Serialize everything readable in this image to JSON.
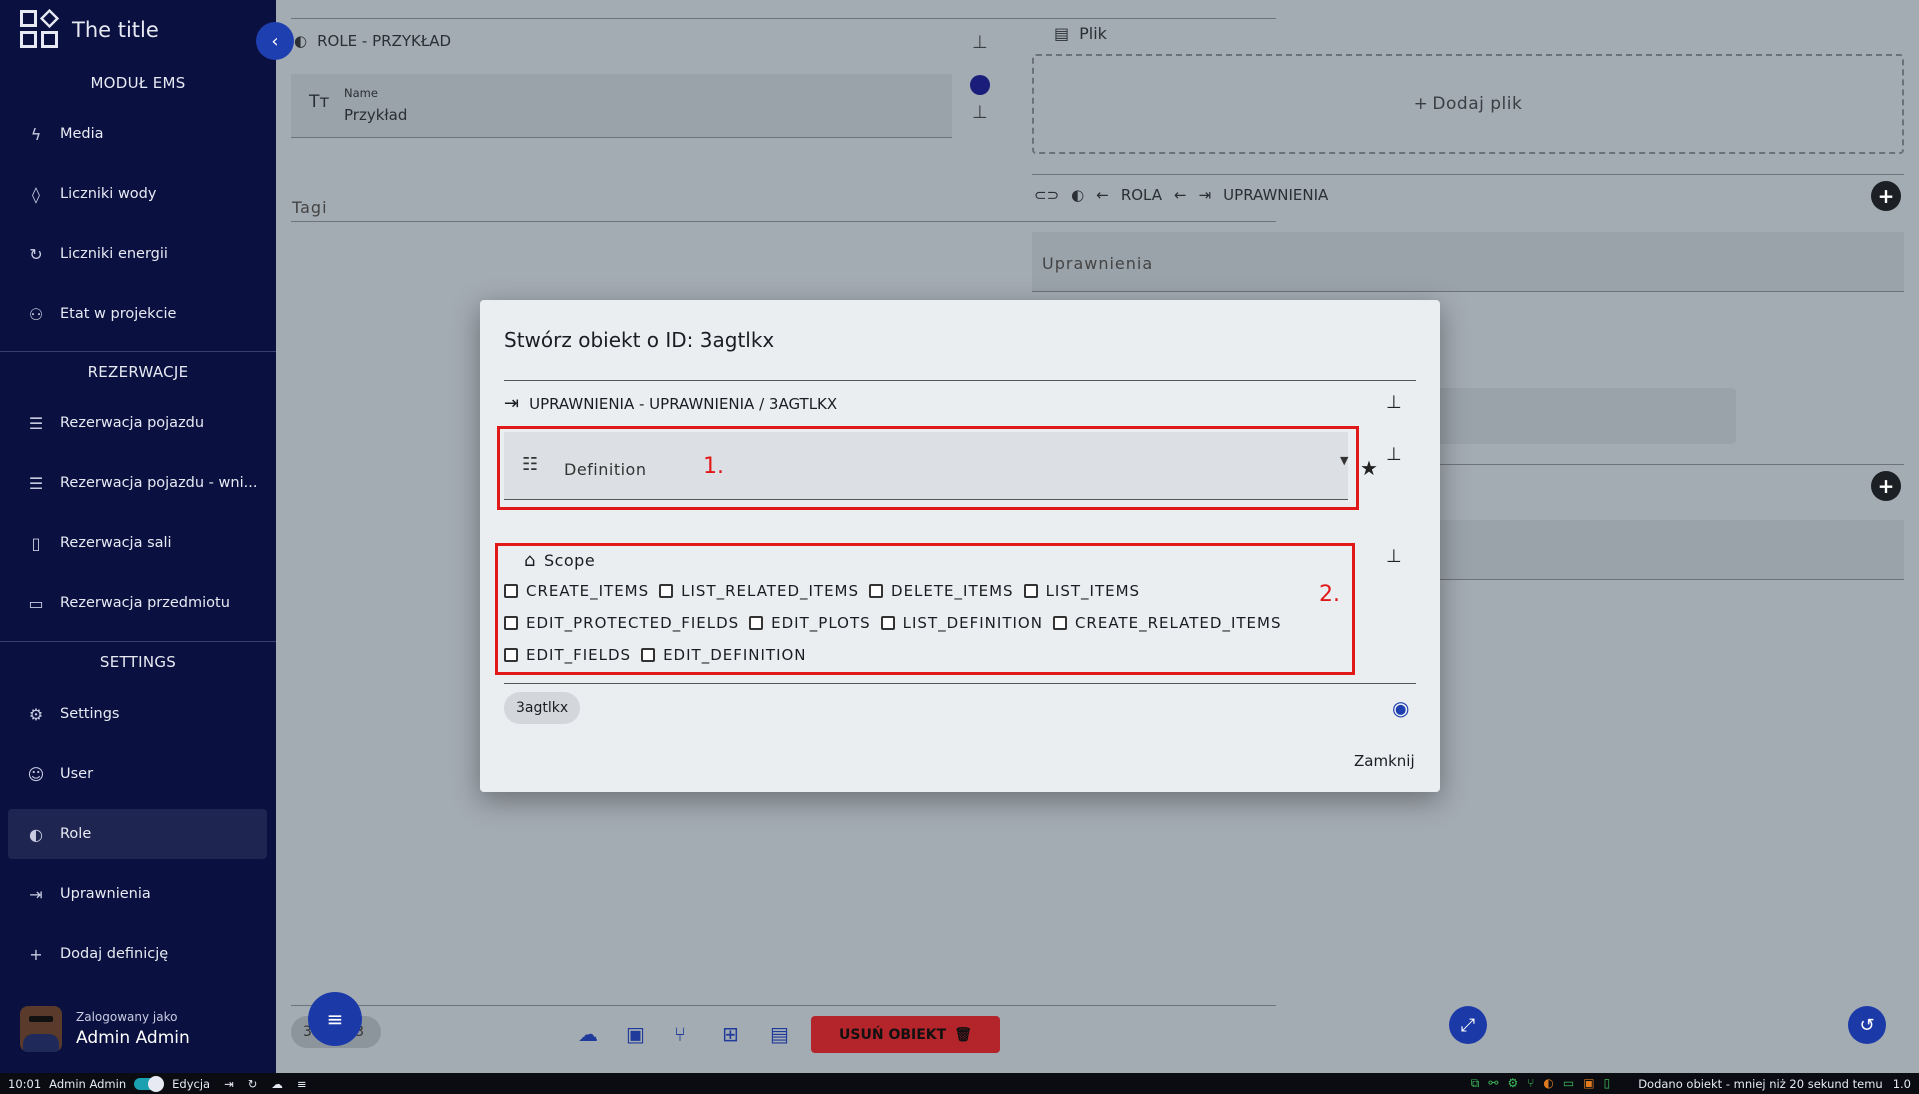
{
  "app": {
    "title": "The title"
  },
  "sidebar": {
    "sections": [
      {
        "title": "MODUŁ EMS",
        "items": [
          {
            "label": "Media",
            "icon": "bolt-icon"
          },
          {
            "label": "Liczniki wody",
            "icon": "drop-icon"
          },
          {
            "label": "Liczniki energii",
            "icon": "history-icon"
          },
          {
            "label": "Etat w projekcie",
            "icon": "people-icon"
          }
        ]
      },
      {
        "title": "REZERWACJE",
        "items": [
          {
            "label": "Rezerwacja pojazdu",
            "icon": "bed-icon"
          },
          {
            "label": "Rezerwacja pojazdu - wni...",
            "icon": "bed-icon"
          },
          {
            "label": "Rezerwacja sali",
            "icon": "bookmark-icon"
          },
          {
            "label": "Rezerwacja przedmiotu",
            "icon": "devices-icon"
          }
        ]
      },
      {
        "title": "SETTINGS",
        "items": [
          {
            "label": "Settings",
            "icon": "gear-icon"
          },
          {
            "label": "User",
            "icon": "face-icon"
          },
          {
            "label": "Role",
            "icon": "palette-icon",
            "active": true
          },
          {
            "label": "Uprawnienia",
            "icon": "login-icon"
          },
          {
            "label": "Dodaj definicję",
            "icon": "plus-icon"
          }
        ]
      }
    ],
    "user": {
      "logged_as": "Zalogowany jako",
      "name": "Admin Admin"
    }
  },
  "background": {
    "role_header": "ROLE - PRZYKŁAD",
    "name_label": "Name",
    "name_value": "Przykład",
    "tags_placeholder": "Tagi",
    "file_label": "Plik",
    "add_file": "Dodaj plik",
    "relation_path": {
      "a": "ROLA",
      "b": "UPRAWNIENIA"
    },
    "permissions_placeholder": "Uprawnienia",
    "id_chip": "3agtlkx3",
    "delete_button": "USUŃ OBIEKT"
  },
  "modal": {
    "title": "Stwórz obiekt o ID: 3agtlkx",
    "path": "UPRAWNIENIA - UPRAWNIENIA / 3AGTLKX",
    "definition_label": "Definition",
    "annotation_1": "1.",
    "annotation_2": "2.",
    "scope_label": "Scope",
    "checkboxes": [
      [
        "CREATE_ITEMS",
        "LIST_RELATED_ITEMS",
        "DELETE_ITEMS",
        "LIST_ITEMS"
      ],
      [
        "EDIT_PROTECTED_FIELDS",
        "EDIT_PLOTS",
        "LIST_DEFINITION",
        "CREATE_RELATED_ITEMS"
      ],
      [
        "EDIT_FIELDS",
        "EDIT_DEFINITION"
      ]
    ],
    "id_chip": "3agtlkx",
    "close_button": "Zamknij"
  },
  "statusbar": {
    "time": "10:01",
    "user": "Admin Admin",
    "edit_label": "Edycja",
    "message": "Dodano obiekt - mniej niż 20 sekund temu",
    "version": "1.0"
  },
  "colors": {
    "sidebar": "#0a1140",
    "accent": "#1e3fb0",
    "danger": "#b3242b",
    "annotation": "#e01818"
  }
}
